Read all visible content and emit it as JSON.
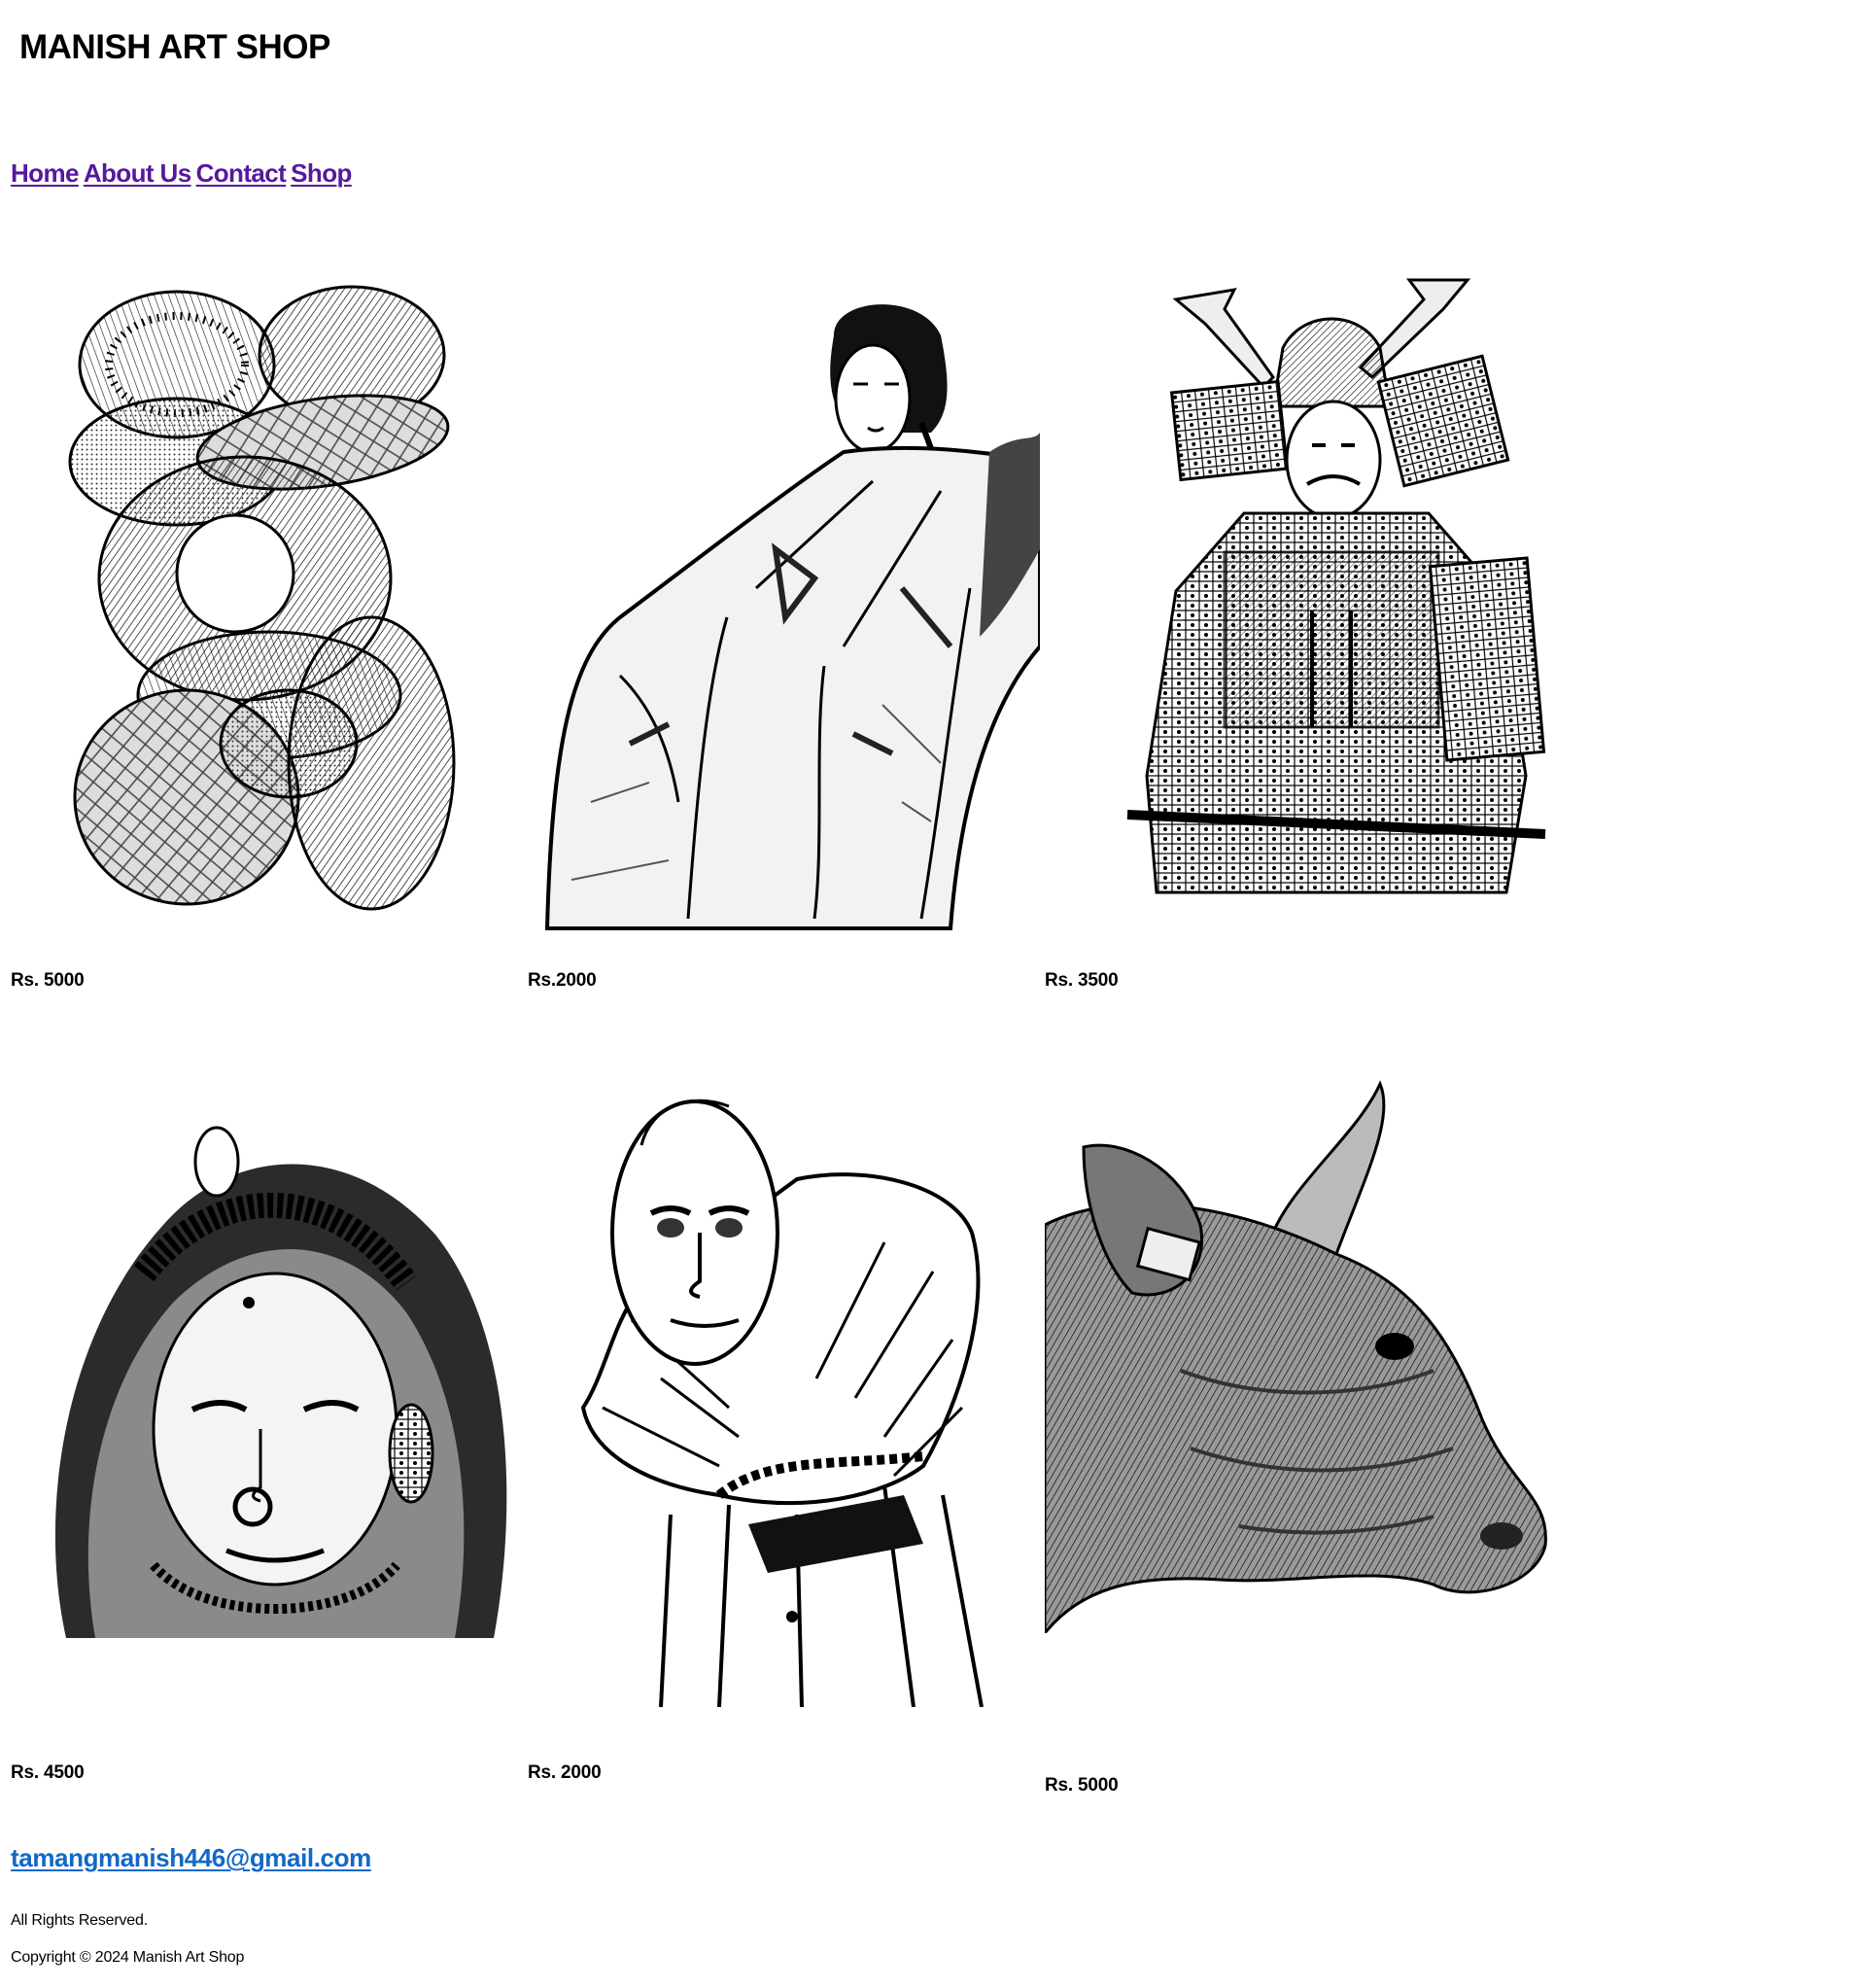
{
  "header": {
    "title": "MANISH ART SHOP"
  },
  "nav": {
    "items": [
      "Home",
      "About Us",
      "Contact",
      "Shop"
    ]
  },
  "products": [
    {
      "price": "Rs. 5000",
      "art": "abstract-linework-artwork"
    },
    {
      "price": "Rs.2000",
      "art": "seated-woman-sketch-artwork"
    },
    {
      "price": "Rs. 3500",
      "art": "samurai-armor-sketch-artwork"
    },
    {
      "price": "Rs. 4500",
      "art": "woman-with-nose-ring-ink-artwork"
    },
    {
      "price": "Rs. 2000",
      "art": "old-man-ruff-collar-sketch-artwork"
    },
    {
      "price": "Rs. 5000",
      "art": "bull-head-crosshatch-artwork"
    }
  ],
  "footer": {
    "email": "tamangmanish446@gmail.com",
    "rights": "All Rights Reserved.",
    "copyright": "Copyright © 2024 Manish Art Shop"
  },
  "colors": {
    "nav_link": "#56189e",
    "email_link": "#1268c9",
    "text": "#000000",
    "background": "#ffffff"
  }
}
